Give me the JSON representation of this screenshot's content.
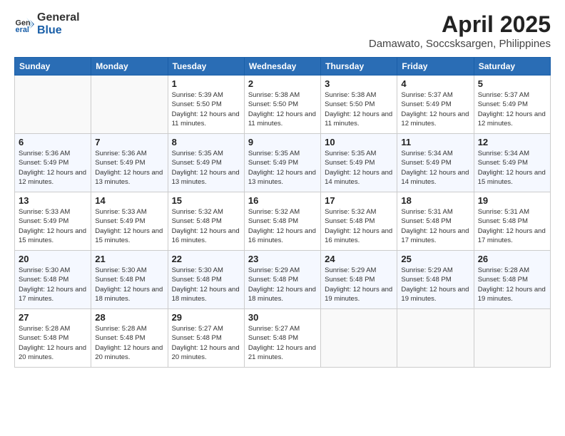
{
  "logo": {
    "general": "General",
    "blue": "Blue"
  },
  "title": "April 2025",
  "subtitle": "Damawato, Soccsksargen, Philippines",
  "days_of_week": [
    "Sunday",
    "Monday",
    "Tuesday",
    "Wednesday",
    "Thursday",
    "Friday",
    "Saturday"
  ],
  "weeks": [
    [
      {
        "day": "",
        "info": ""
      },
      {
        "day": "",
        "info": ""
      },
      {
        "day": "1",
        "info": "Sunrise: 5:39 AM\nSunset: 5:50 PM\nDaylight: 12 hours and 11 minutes."
      },
      {
        "day": "2",
        "info": "Sunrise: 5:38 AM\nSunset: 5:50 PM\nDaylight: 12 hours and 11 minutes."
      },
      {
        "day": "3",
        "info": "Sunrise: 5:38 AM\nSunset: 5:50 PM\nDaylight: 12 hours and 11 minutes."
      },
      {
        "day": "4",
        "info": "Sunrise: 5:37 AM\nSunset: 5:49 PM\nDaylight: 12 hours and 12 minutes."
      },
      {
        "day": "5",
        "info": "Sunrise: 5:37 AM\nSunset: 5:49 PM\nDaylight: 12 hours and 12 minutes."
      }
    ],
    [
      {
        "day": "6",
        "info": "Sunrise: 5:36 AM\nSunset: 5:49 PM\nDaylight: 12 hours and 12 minutes."
      },
      {
        "day": "7",
        "info": "Sunrise: 5:36 AM\nSunset: 5:49 PM\nDaylight: 12 hours and 13 minutes."
      },
      {
        "day": "8",
        "info": "Sunrise: 5:35 AM\nSunset: 5:49 PM\nDaylight: 12 hours and 13 minutes."
      },
      {
        "day": "9",
        "info": "Sunrise: 5:35 AM\nSunset: 5:49 PM\nDaylight: 12 hours and 13 minutes."
      },
      {
        "day": "10",
        "info": "Sunrise: 5:35 AM\nSunset: 5:49 PM\nDaylight: 12 hours and 14 minutes."
      },
      {
        "day": "11",
        "info": "Sunrise: 5:34 AM\nSunset: 5:49 PM\nDaylight: 12 hours and 14 minutes."
      },
      {
        "day": "12",
        "info": "Sunrise: 5:34 AM\nSunset: 5:49 PM\nDaylight: 12 hours and 15 minutes."
      }
    ],
    [
      {
        "day": "13",
        "info": "Sunrise: 5:33 AM\nSunset: 5:49 PM\nDaylight: 12 hours and 15 minutes."
      },
      {
        "day": "14",
        "info": "Sunrise: 5:33 AM\nSunset: 5:49 PM\nDaylight: 12 hours and 15 minutes."
      },
      {
        "day": "15",
        "info": "Sunrise: 5:32 AM\nSunset: 5:48 PM\nDaylight: 12 hours and 16 minutes."
      },
      {
        "day": "16",
        "info": "Sunrise: 5:32 AM\nSunset: 5:48 PM\nDaylight: 12 hours and 16 minutes."
      },
      {
        "day": "17",
        "info": "Sunrise: 5:32 AM\nSunset: 5:48 PM\nDaylight: 12 hours and 16 minutes."
      },
      {
        "day": "18",
        "info": "Sunrise: 5:31 AM\nSunset: 5:48 PM\nDaylight: 12 hours and 17 minutes."
      },
      {
        "day": "19",
        "info": "Sunrise: 5:31 AM\nSunset: 5:48 PM\nDaylight: 12 hours and 17 minutes."
      }
    ],
    [
      {
        "day": "20",
        "info": "Sunrise: 5:30 AM\nSunset: 5:48 PM\nDaylight: 12 hours and 17 minutes."
      },
      {
        "day": "21",
        "info": "Sunrise: 5:30 AM\nSunset: 5:48 PM\nDaylight: 12 hours and 18 minutes."
      },
      {
        "day": "22",
        "info": "Sunrise: 5:30 AM\nSunset: 5:48 PM\nDaylight: 12 hours and 18 minutes."
      },
      {
        "day": "23",
        "info": "Sunrise: 5:29 AM\nSunset: 5:48 PM\nDaylight: 12 hours and 18 minutes."
      },
      {
        "day": "24",
        "info": "Sunrise: 5:29 AM\nSunset: 5:48 PM\nDaylight: 12 hours and 19 minutes."
      },
      {
        "day": "25",
        "info": "Sunrise: 5:29 AM\nSunset: 5:48 PM\nDaylight: 12 hours and 19 minutes."
      },
      {
        "day": "26",
        "info": "Sunrise: 5:28 AM\nSunset: 5:48 PM\nDaylight: 12 hours and 19 minutes."
      }
    ],
    [
      {
        "day": "27",
        "info": "Sunrise: 5:28 AM\nSunset: 5:48 PM\nDaylight: 12 hours and 20 minutes."
      },
      {
        "day": "28",
        "info": "Sunrise: 5:28 AM\nSunset: 5:48 PM\nDaylight: 12 hours and 20 minutes."
      },
      {
        "day": "29",
        "info": "Sunrise: 5:27 AM\nSunset: 5:48 PM\nDaylight: 12 hours and 20 minutes."
      },
      {
        "day": "30",
        "info": "Sunrise: 5:27 AM\nSunset: 5:48 PM\nDaylight: 12 hours and 21 minutes."
      },
      {
        "day": "",
        "info": ""
      },
      {
        "day": "",
        "info": ""
      },
      {
        "day": "",
        "info": ""
      }
    ]
  ]
}
